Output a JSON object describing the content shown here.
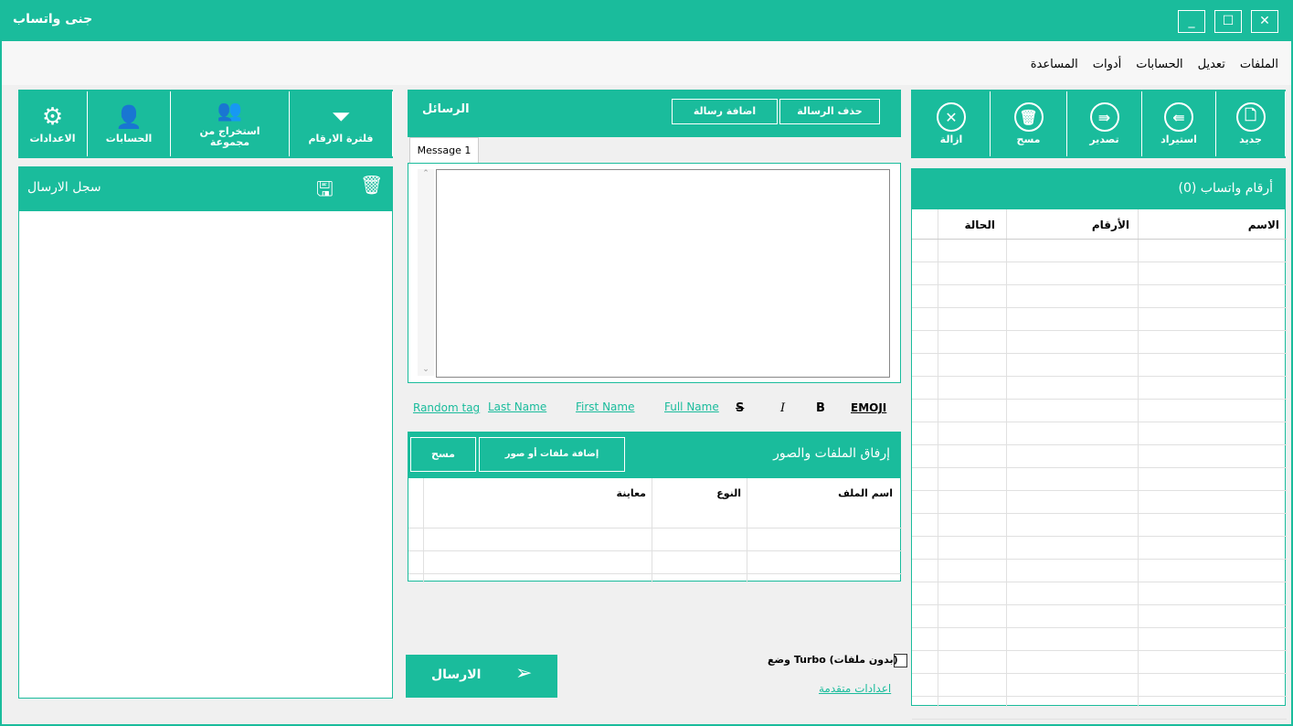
{
  "window": {
    "title": "جنى واتساب",
    "minimize": "_",
    "maximize": "☐",
    "close": "✕"
  },
  "menu": [
    "الملفات",
    "تعديل",
    "الحسابات",
    "أدوات",
    "المساعدة"
  ],
  "right_toolbar": [
    {
      "label": "جديد",
      "icon": "new-file-icon",
      "glyph": "🗋"
    },
    {
      "label": "استيراد",
      "icon": "import-icon",
      "glyph": "⇚"
    },
    {
      "label": "تصدير",
      "icon": "export-icon",
      "glyph": "⇛"
    },
    {
      "label": "مسح",
      "icon": "trash-icon",
      "glyph": "🗑"
    },
    {
      "label": "ازالة",
      "icon": "remove-icon",
      "glyph": "✕"
    }
  ],
  "numbers_panel": {
    "title": "أرقام واتساب (0)",
    "columns": [
      "الاسم",
      "الأرقام",
      "الحالة"
    ]
  },
  "messages_panel": {
    "title": "الرسائل",
    "delete_button": "حذف الرسالة",
    "add_button": "اضافة رسالة",
    "tab": "Message 1"
  },
  "format_bar": {
    "emoji": "EMOJI",
    "bold": "B",
    "italic": "I",
    "strike": "S",
    "full_name": "Full Name",
    "first_name": "First Name",
    "last_name": "Last Name",
    "random_tag": "Random tag"
  },
  "attach_panel": {
    "title": "إرفاق الملفات والصور",
    "add_button": "إضافة ملفات أو صور",
    "clear_button": "مسح",
    "columns": [
      "اسم الملف",
      "النوع",
      "معاينة"
    ]
  },
  "send_button": "الارسال",
  "turbo_label": "وضع Turbo (بدون ملفات)",
  "advanced_link": "اعدادات متقدمة",
  "left_toolbar": [
    {
      "label": "فلترة الارقام",
      "icon": "filter-icon",
      "glyph": "⏷"
    },
    {
      "label": "استخراج من مجموعة",
      "icon": "group-icon",
      "glyph": "👥"
    },
    {
      "label": "الحسابات",
      "icon": "add-user-icon",
      "glyph": "👤"
    },
    {
      "label": "الاعدادات",
      "icon": "gear-icon",
      "glyph": "⚙"
    }
  ],
  "log_panel": {
    "title": "سجل الارسال"
  },
  "colors": {
    "accent": "#1abc9c",
    "background": "#f0f0f0"
  }
}
